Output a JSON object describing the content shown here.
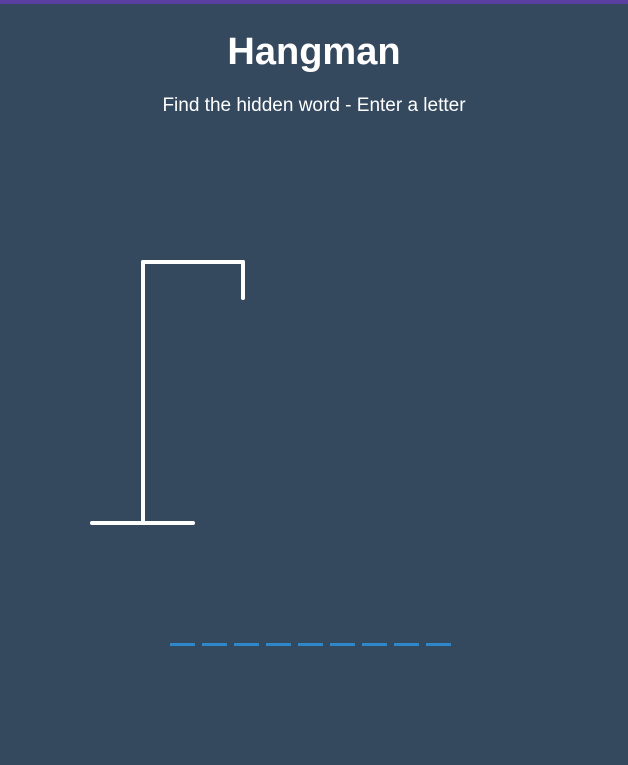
{
  "game": {
    "title": "Hangman",
    "subtitle": "Find the hidden word - Enter a letter"
  },
  "figure": {
    "stroke_color": "#ffffff",
    "wrong_guesses": 0,
    "parts_visible": [
      "base",
      "pole",
      "beam",
      "rope"
    ]
  },
  "word": {
    "length": 9,
    "revealed": [
      "",
      "",
      "",
      "",
      "",
      "",
      "",
      "",
      ""
    ],
    "underline_color": "#2f86c8"
  },
  "theme": {
    "background": "#34495e",
    "accent_strip": "#5b3fa0"
  }
}
